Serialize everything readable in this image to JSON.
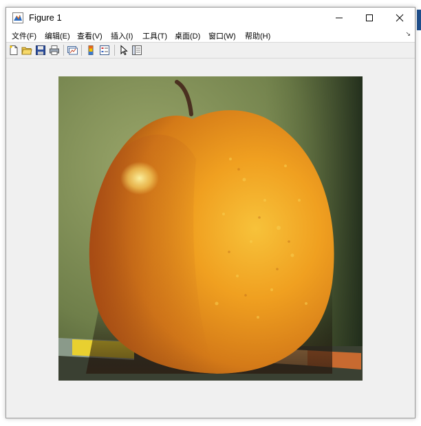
{
  "window": {
    "title": "Figure 1",
    "controls": {
      "minimize": "minimize",
      "maximize": "maximize",
      "close": "close"
    }
  },
  "menubar": {
    "items": [
      {
        "label": "文件(F)"
      },
      {
        "label": "编辑(E)"
      },
      {
        "label": "查看(V)"
      },
      {
        "label": "插入(I)"
      },
      {
        "label": "工具(T)"
      },
      {
        "label": "桌面(D)"
      },
      {
        "label": "窗口(W)"
      },
      {
        "label": "帮助(H)"
      }
    ]
  },
  "toolbar": {
    "buttons": [
      {
        "icon": "new-figure-icon"
      },
      {
        "icon": "open-file-icon"
      },
      {
        "icon": "save-icon"
      },
      {
        "icon": "print-icon"
      },
      {
        "icon": "link-plot-icon"
      },
      {
        "icon": "colorbar-icon"
      },
      {
        "icon": "legend-icon"
      },
      {
        "icon": "select-pointer-icon"
      },
      {
        "icon": "property-editor-icon"
      }
    ]
  },
  "figure": {
    "image": "photo-apple-with-pencil",
    "colors": {
      "background": "#6f7f4a",
      "apple_left": "#c2661a",
      "apple_right": "#f0a020",
      "highlight": "#f5e27a",
      "pencil": "#e8d030"
    }
  }
}
